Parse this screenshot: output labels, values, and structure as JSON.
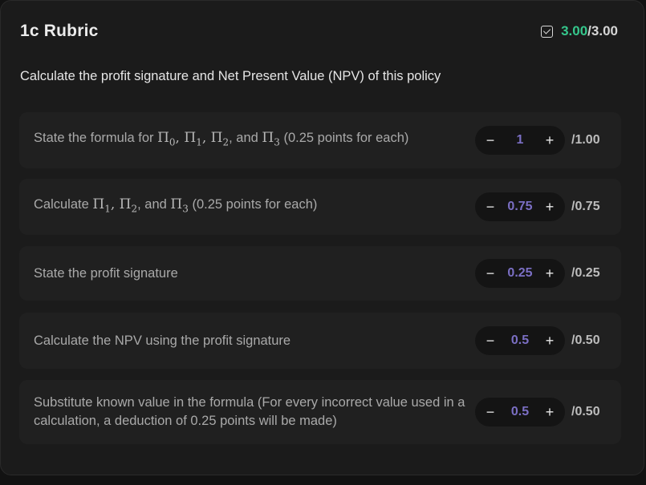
{
  "rubric": {
    "title": "1c Rubric",
    "score_earned": "3.00",
    "score_sep": "/",
    "score_total": "3.00",
    "prompt": "Calculate the profit signature and Net Present Value (NPV) of this policy"
  },
  "items": [
    {
      "label_pre": "State the formula for ",
      "label_post": " (0.25 points for each)",
      "value": "1",
      "max": "/1.00"
    },
    {
      "label_pre": "Calculate ",
      "label_post": " (0.25 points for each)",
      "value": "0.75",
      "max": "/0.75"
    },
    {
      "label": "State the profit signature",
      "value": "0.25",
      "max": "/0.25"
    },
    {
      "label": "Calculate the NPV using the profit signature",
      "value": "0.5",
      "max": "/0.50"
    },
    {
      "label": "Substitute known value in the formula (For every incorrect value used in a calculation, a deduction of 0.25 points will be made)",
      "value": "0.5",
      "max": "/0.50"
    }
  ],
  "math": {
    "pi": "Π",
    "sub0": "0",
    "sub1": "1",
    "sub2": "2",
    "sub3": "3",
    "comma": ", ",
    "and": ", and "
  },
  "controls": {
    "decrement": "−",
    "increment": "+"
  },
  "colors": {
    "earned": "#35c78c",
    "value": "#7b6fc4",
    "background": "#1b1b1b",
    "card": "#202020"
  },
  "icons": {
    "score_check": "checkbox-checked-icon"
  }
}
